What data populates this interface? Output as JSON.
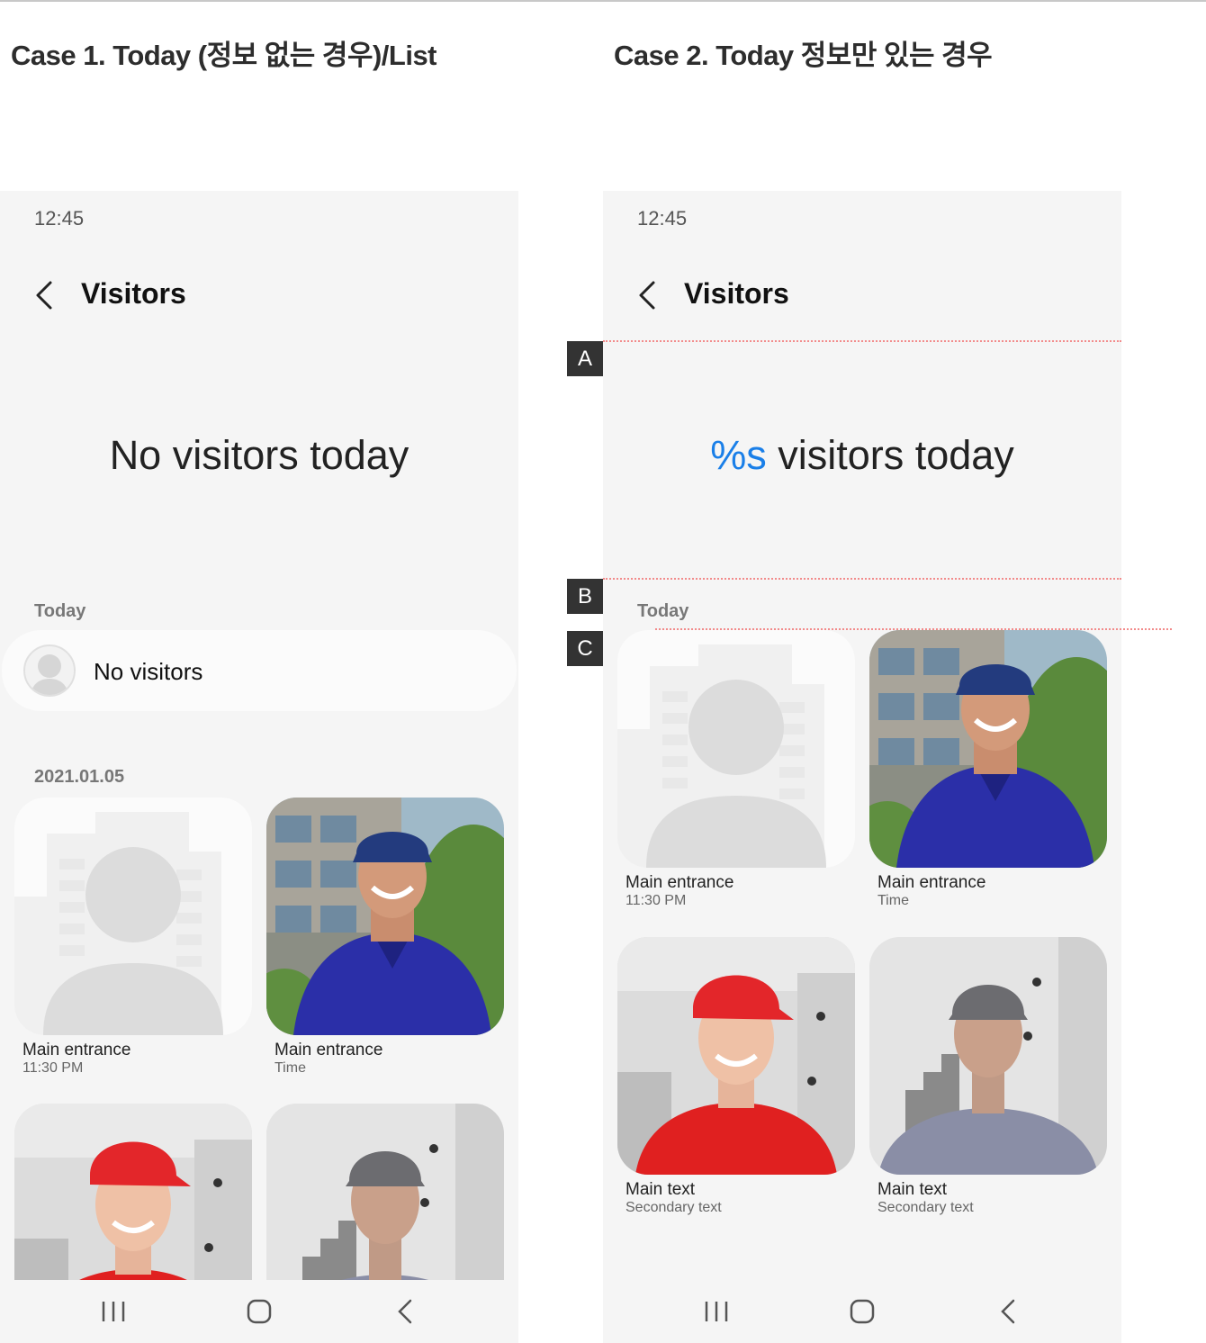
{
  "case1": {
    "title": "Case 1. Today (정보 없는 경우)/List",
    "status_time": "12:45",
    "app_title": "Visitors",
    "hero_text": "No visitors today",
    "today_label": "Today",
    "no_visitors_label": "No visitors",
    "date_label": "2021.01.05",
    "tiles": [
      {
        "main": "Main entrance",
        "sub": "11:30 PM",
        "image": "placeholder-person"
      },
      {
        "main": "Main entrance",
        "sub": "Time",
        "image": "delivery-man-blue-cap"
      },
      {
        "main": "",
        "sub": "",
        "image": "woman-red-cap"
      },
      {
        "main": "",
        "sub": "",
        "image": "man-grey-cap"
      }
    ]
  },
  "case2": {
    "title": "Case 2. Today 정보만 있는 경우",
    "status_time": "12:45",
    "app_title": "Visitors",
    "hero_count": "%s",
    "hero_text": " visitors today",
    "today_label": "Today",
    "tiles": [
      {
        "main": "Main entrance",
        "sub": "11:30 PM",
        "image": "placeholder-person"
      },
      {
        "main": "Main entrance",
        "sub": "Time",
        "image": "delivery-man-blue-cap"
      },
      {
        "main": "Main text",
        "sub": "Secondary text",
        "image": "woman-red-cap"
      },
      {
        "main": "Main text",
        "sub": "Secondary text",
        "image": "man-grey-cap"
      }
    ]
  },
  "markers": [
    "A",
    "B",
    "C"
  ],
  "nav_icons": [
    "recent-apps-icon",
    "home-icon",
    "back-icon"
  ],
  "colors": {
    "accent": "#1a7fe8",
    "guide": "#f28b8b",
    "phone_bg": "#f5f5f5"
  }
}
